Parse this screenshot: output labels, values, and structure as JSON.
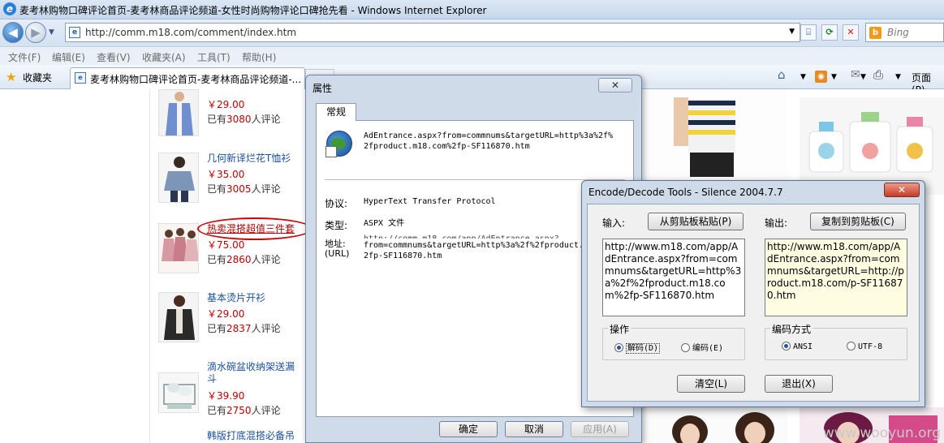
{
  "window": {
    "title": "麦考林购物口碑评论首页-麦考林商品评论频道-女性时尚购物评论口碑抢先看 - Windows Internet Explorer",
    "logo_glyph": "e"
  },
  "address_bar": {
    "url": "http://comm.m18.com/comment/index.htm"
  },
  "search": {
    "placeholder": "Bing"
  },
  "menu": [
    "文件(F)",
    "编辑(E)",
    "查看(V)",
    "收藏夹(A)",
    "工具(T)",
    "帮助(H)"
  ],
  "favorites": {
    "label": "收藏夹",
    "tab_title": "麦考林购物口碑评论首页-麦考林商品评论频道-..."
  },
  "command_bar": {
    "page_label": "页面(P)"
  },
  "products": [
    {
      "name": "",
      "price": "￥29.00",
      "rev_prefix": "已有",
      "rev_count": "3080",
      "rev_suffix": "人评论"
    },
    {
      "name": "几何新译烂花T恤衫",
      "price": "￥35.00",
      "rev_prefix": "已有",
      "rev_count": "3005",
      "rev_suffix": "人评论"
    },
    {
      "name": "热卖混搭超值三件套",
      "price": "￥75.00",
      "rev_prefix": "已有",
      "rev_count": "2860",
      "rev_suffix": "人评论"
    },
    {
      "name": "基本烫片开衫",
      "price": "￥29.00",
      "rev_prefix": "已有",
      "rev_count": "2837",
      "rev_suffix": "人评论"
    },
    {
      "name": "滴水碗盆收纳架送漏斗",
      "price": "￥39.90",
      "rev_prefix": "已有",
      "rev_count": "2750",
      "rev_suffix": "人评论"
    },
    {
      "name": "韩版打底混搭必备吊",
      "price": "",
      "rev_prefix": "",
      "rev_count": "",
      "rev_suffix": ""
    }
  ],
  "watermark": "www.wooyun.org",
  "properties_dialog": {
    "title": "属性",
    "close_glyph": "✕",
    "tab": "常规",
    "name": "AdEntrance.aspx?from=commnums&targetURL=http%3a%2f%2fproduct.m18.com%2fp-SF116870.htm",
    "protocol_label": "协议:",
    "protocol_value": "HyperText Transfer Protocol",
    "type_label": "类型:",
    "type_value": "ASPX 文件",
    "address_label": "地址:\n(URL)",
    "address_overlap": "http://comm.m18.com/app/AdEntrance.aspx?",
    "address_value": "from=commnums&targetURL=http%3a%2f%2fproduct.m18.com%2fp-SF116870.htm",
    "ok": "确定",
    "cancel": "取消",
    "apply": "应用(A)"
  },
  "encode_dialog": {
    "title": "Encode/Decode  Tools - Silence 2004.7.7",
    "close_glyph": "✕",
    "input_label": "输入:",
    "paste_button": "从剪贴板粘贴(P)",
    "output_label": "输出:",
    "copy_button": "复制到剪贴板(C)",
    "input_text": "http://www.m18.com/app/AdEntrance.aspx?from=commnums&targetURL=http%3a%2f%2fproduct.m18.com%2fp-SF116870.htm",
    "output_text": "http://www.m18.com/app/AdEntrance.aspx?from=commnums&targetURL=http://product.m18.com/p-SF116870.htm",
    "operation_label": "操作",
    "decode_option": "解码(D)",
    "encode_option": "编码(E)",
    "operation_selected": "解码(D)",
    "encoding_label": "编码方式",
    "ansi_option": "ANSI",
    "utf8_option": "UTF-8",
    "encoding_selected": "ANSI",
    "clear_button": "清空(L)",
    "exit_button": "退出(X)"
  }
}
